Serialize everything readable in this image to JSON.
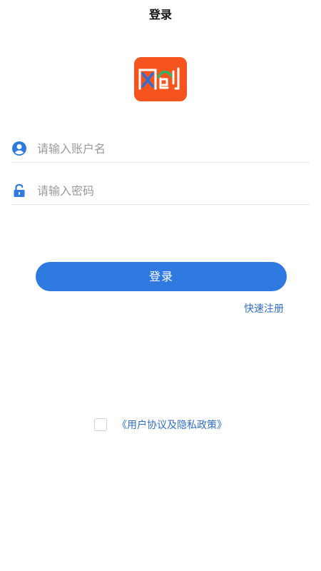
{
  "header": {
    "title": "登录"
  },
  "logo": {
    "text": "网创",
    "bg_color": "#f5541c"
  },
  "form": {
    "username": {
      "placeholder": "请输入账户名",
      "value": "",
      "icon": "user-icon"
    },
    "password": {
      "placeholder": "请输入密码",
      "value": "",
      "icon": "lock-icon"
    }
  },
  "actions": {
    "login_label": "登录",
    "register_label": "快速注册"
  },
  "agreement": {
    "checked": false,
    "link_text": "《用户协议及隐私政策》"
  },
  "colors": {
    "primary": "#2f7ae0",
    "link": "#2f6fc6",
    "placeholder": "#9a9a9a"
  }
}
